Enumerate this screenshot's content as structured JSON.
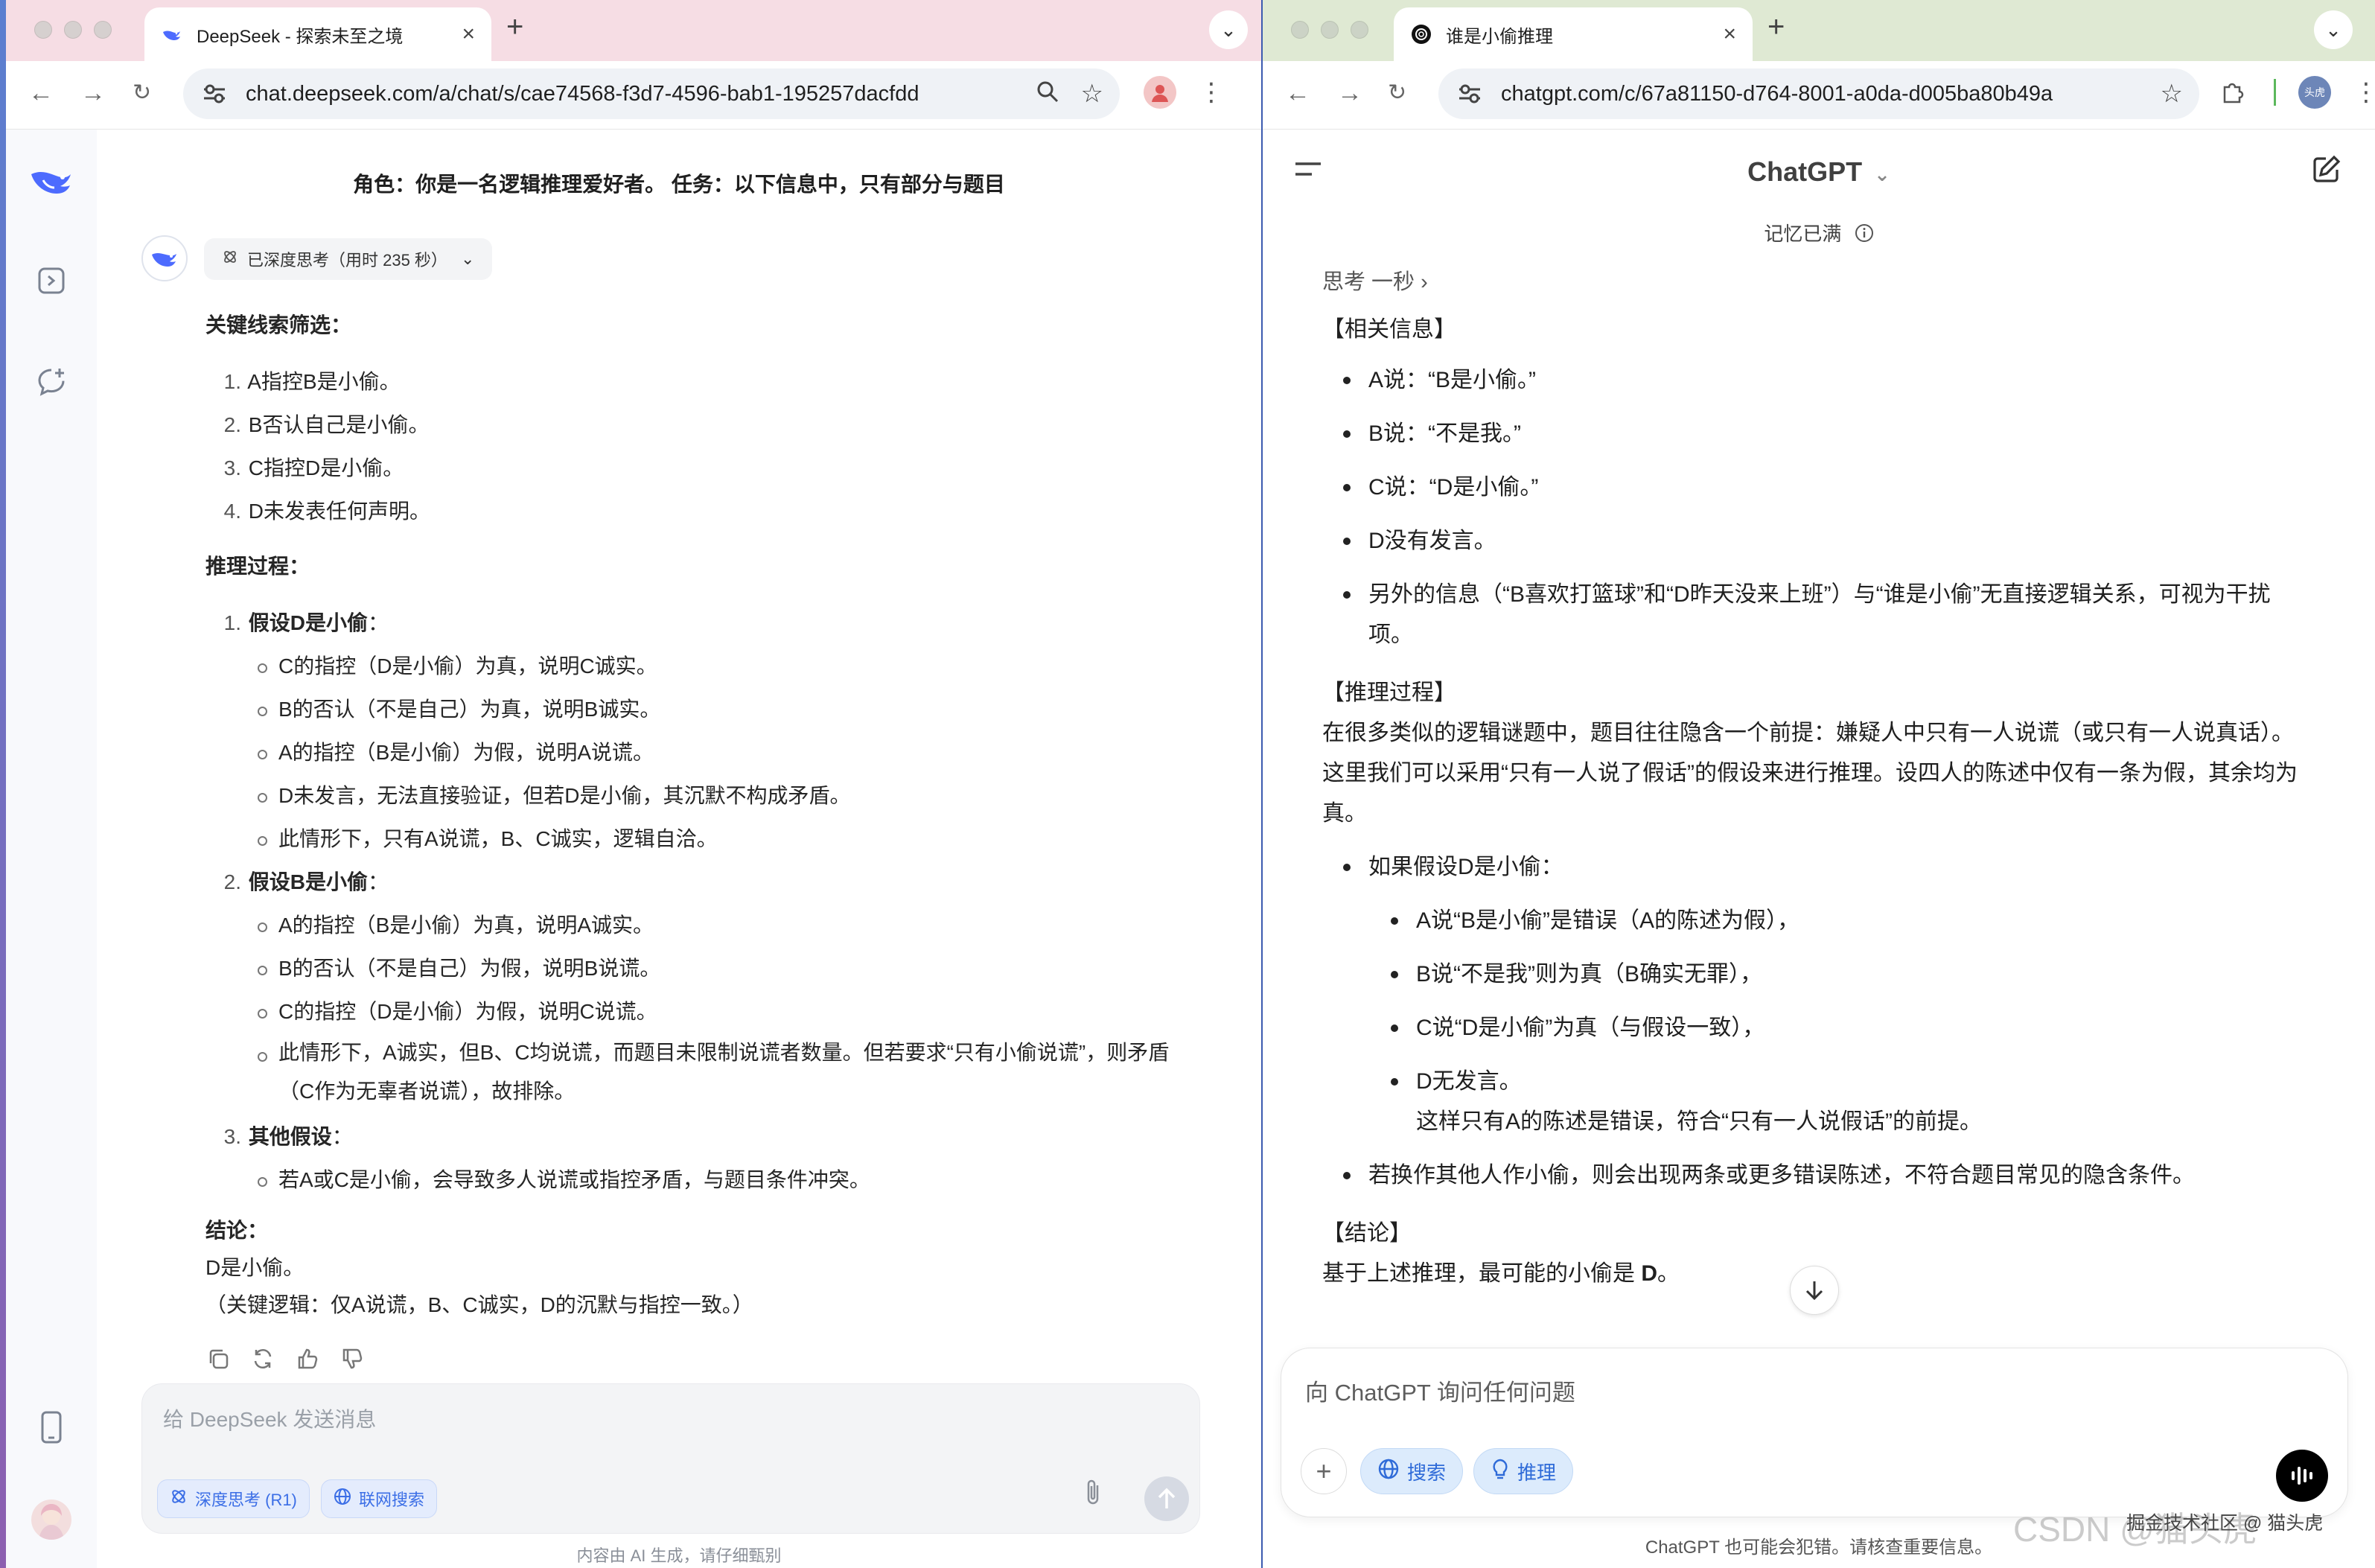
{
  "left": {
    "tab_title": "DeepSeek - 探索未至之境",
    "url": "chat.deepseek.com/a/chat/s/cae74568-f3d7-4596-bab1-195257dacfdd",
    "prompt": "角色：你是一名逻辑推理爱好者。 任务：以下信息中，只有部分与题目",
    "think_chip": "已深度思考（用时 235 秒）",
    "sec1": "关键线索筛选：",
    "clues": [
      {
        "n": "1.",
        "t": "A指控B是小偷。"
      },
      {
        "n": "2.",
        "t": "B否认自己是小偷。"
      },
      {
        "n": "3.",
        "t": "C指控D是小偷。"
      },
      {
        "n": "4.",
        "t": "D未发表任何声明。"
      }
    ],
    "sec2": "推理过程：",
    "case1": {
      "n": "1.",
      "title": "假设D是小偷",
      "colon": "：",
      "items": [
        "C的指控（D是小偷）为真，说明C诚实。",
        "B的否认（不是自己）为真，说明B诚实。",
        "A的指控（B是小偷）为假，说明A说谎。",
        "D未发言，无法直接验证，但若D是小偷，其沉默不构成矛盾。",
        "此情形下，只有A说谎，B、C诚实，逻辑自洽。"
      ]
    },
    "case2": {
      "n": "2.",
      "title": "假设B是小偷",
      "colon": "：",
      "items": [
        "A的指控（B是小偷）为真，说明A诚实。",
        "B的否认（不是自己）为假，说明B说谎。",
        "C的指控（D是小偷）为假，说明C说谎。",
        "此情形下，A诚实，但B、C均说谎，而题目未限制说谎者数量。但若要求“只有小偷说谎”，则矛盾（C作为无辜者说谎），故排除。"
      ]
    },
    "case3": {
      "n": "3.",
      "title": "其他假设",
      "colon": "：",
      "items": [
        "若A或C是小偷，会导致多人说谎或指控矛盾，与题目条件冲突。"
      ]
    },
    "sec3": "结论：",
    "conclusion": "D是小偷。",
    "key_logic": "（关键逻辑：仅A说谎，B、C诚实，D的沉默与指控一致。）",
    "input_placeholder": "给 DeepSeek 发送消息",
    "chip_deep": "深度思考 (R1)",
    "chip_search": "联网搜索",
    "footer": "内容由 AI 生成，请仔细甄别"
  },
  "right": {
    "tab_title": "谁是小偷推理",
    "url": "chatgpt.com/c/67a81150-d764-8001-a0da-d005ba80b49a",
    "profile_label": "头虎",
    "model": "ChatGPT",
    "memory": "记忆已满",
    "thought": "思考 一秒",
    "sec1": "【相关信息】",
    "info": [
      "A说：“B是小偷。”",
      "B说：“不是我。”",
      "C说：“D是小偷。”",
      "D没有发言。",
      "另外的信息（“B喜欢打篮球”和“D昨天没来上班”）与“谁是小偷”无直接逻辑关系，可视为干扰项。"
    ],
    "sec2": "【推理过程】",
    "para": "在很多类似的逻辑谜题中，题目往往隐含一个前提：嫌疑人中只有一人说谎（或只有一人说真话）。这里我们可以采用“只有一人说了假话”的假设来进行推理。设四人的陈述中仅有一条为假，其余均为真。",
    "hyp": "如果假设D是小偷：",
    "hyp_items": [
      "A说“B是小偷”是错误（A的陈述为假），",
      "B说“不是我”则为真（B确实无罪），",
      "C说“D是小偷”为真（与假设一致），",
      "D无发言。"
    ],
    "hyp_note": "这样只有A的陈述是错误，符合“只有一人说假话”的前提。",
    "other": "若换作其他人作小偷，则会出现两条或更多错误陈述，不符合题目常见的隐含条件。",
    "sec3": "【结论】",
    "concl_prefix": "基于上述推理，最可能的小偷是 ",
    "concl_answer": "D",
    "concl_suffix": "。",
    "input_placeholder": "向 ChatGPT 询问任何问题",
    "chip_search": "搜索",
    "chip_reason": "推理",
    "footer": "ChatGPT 也可能会犯错。请核查重要信息。"
  },
  "watermark": "CSDN @猫头虎",
  "watermark_small": "掘金技术社区 @ 猫头虎"
}
